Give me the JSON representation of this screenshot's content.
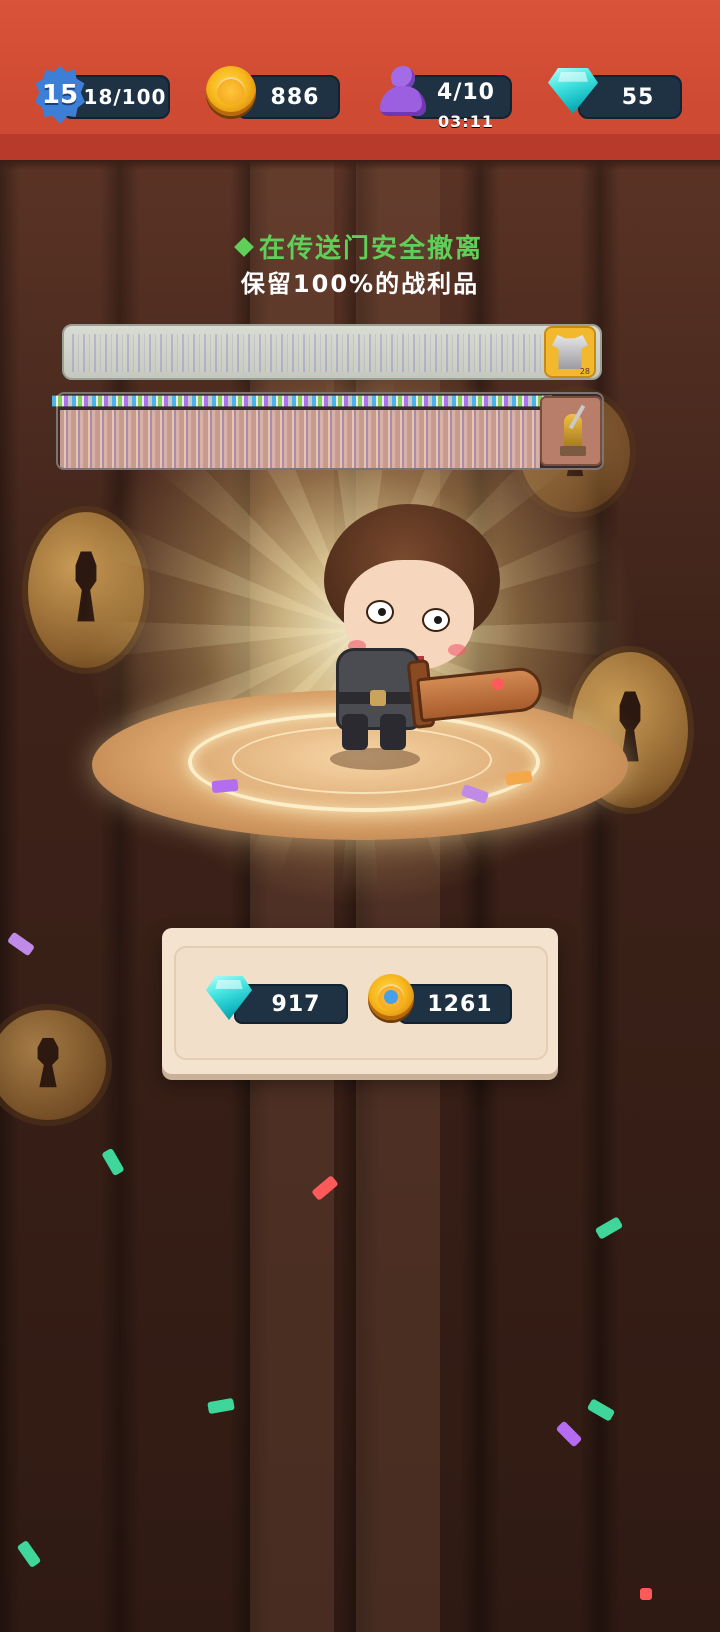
{
  "hud": {
    "level": "15",
    "xp": "18/100",
    "coins": "886",
    "energy": "4/10",
    "energy_timer": "03:11",
    "gems": "55"
  },
  "messages": {
    "line1": "在传送门安全撤离",
    "line2": "保留100%的战利品"
  },
  "loot": {
    "armor_count": "28"
  },
  "rewards": {
    "gems": "917",
    "coins": "1261"
  },
  "colors": {
    "topbar": "#d9533a",
    "pill": "#1f3244",
    "message_green": "#5fcf59",
    "panel": "#f4e3cf"
  },
  "icons": [
    "level-star-badge-icon",
    "gold-coin-icon",
    "energy-pawn-icon",
    "gem-icon",
    "armor-icon",
    "statue-icon"
  ]
}
